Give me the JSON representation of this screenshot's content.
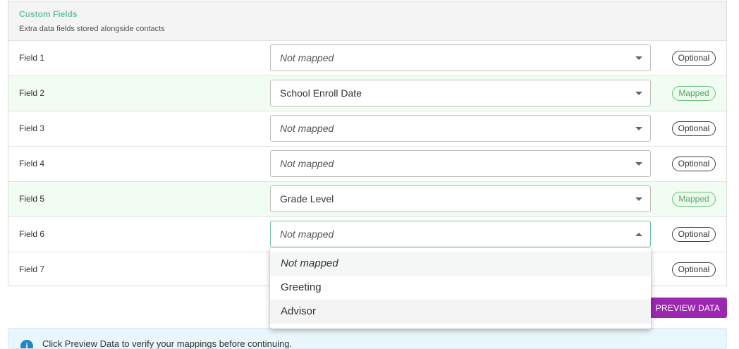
{
  "section": {
    "title": "Custom Fields",
    "subtitle": "Extra data fields stored alongside contacts"
  },
  "fields": [
    {
      "label": "Field 1",
      "value": "Not mapped",
      "status": "Optional"
    },
    {
      "label": "Field 2",
      "value": "School Enroll Date",
      "status": "Mapped"
    },
    {
      "label": "Field 3",
      "value": "Not mapped",
      "status": "Optional"
    },
    {
      "label": "Field 4",
      "value": "Not mapped",
      "status": "Optional"
    },
    {
      "label": "Field 5",
      "value": "Grade Level",
      "status": "Mapped"
    },
    {
      "label": "Field 6",
      "value": "Not mapped",
      "status": "Optional"
    },
    {
      "label": "Field 7",
      "value": "",
      "status": "Optional"
    }
  ],
  "dropdown": {
    "options": [
      "Not mapped",
      "Greeting",
      "Advisor"
    ]
  },
  "actions": {
    "preview_label": "PREVIEW DATA"
  },
  "info": {
    "icon": "info-icon",
    "glyph": "i",
    "text": "Click Preview Data to verify your mappings before continuing."
  },
  "colors": {
    "accent": "#6cc4a8",
    "mapped_row_bg": "#f1fcf2",
    "mapped_badge": "#5aaa66",
    "preview_button": "#9c27b0",
    "info_bg": "#e9f6fc"
  }
}
